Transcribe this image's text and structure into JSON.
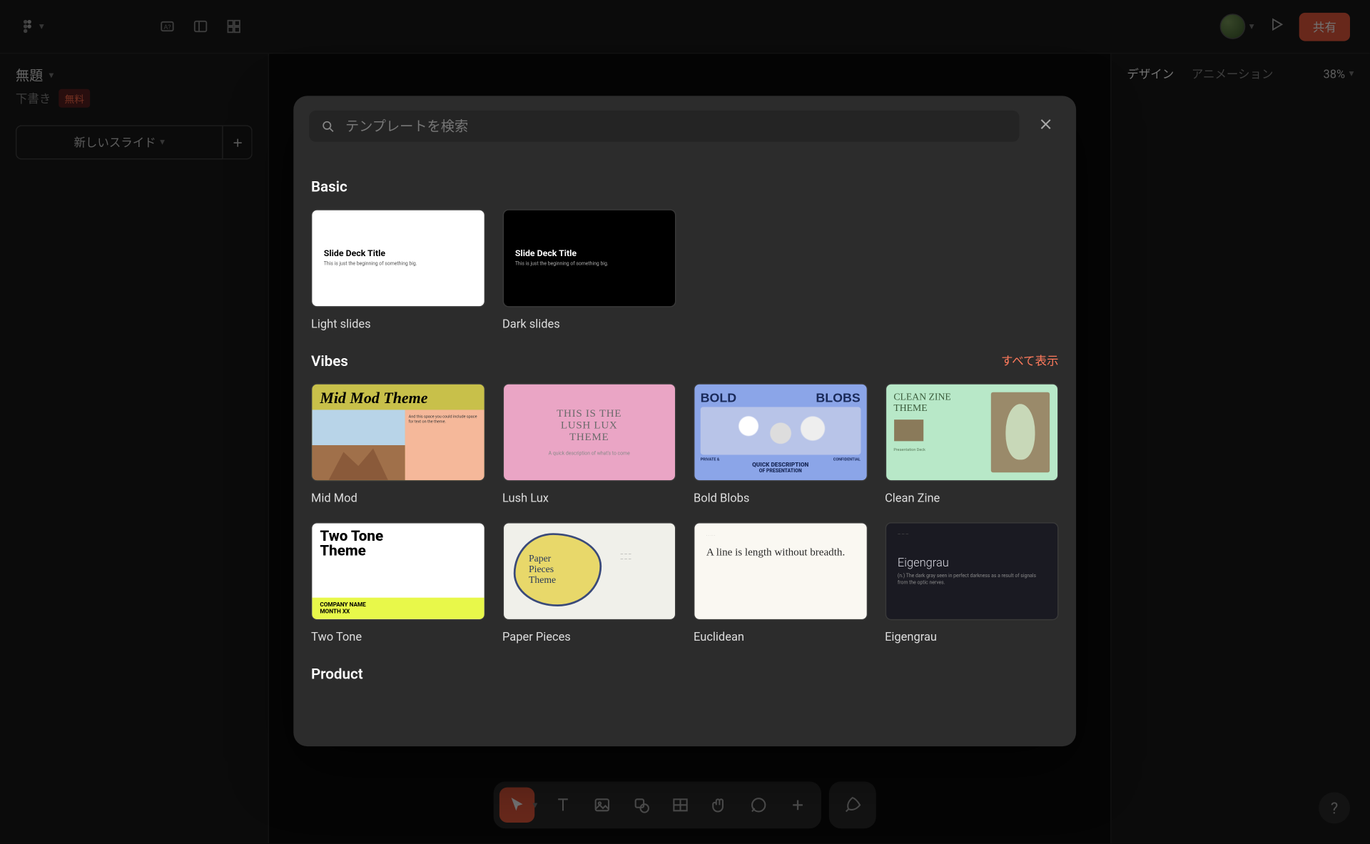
{
  "topbar": {
    "title": "無題",
    "draft": "下書き",
    "free_badge": "無料",
    "share": "共有",
    "new_slide": "新しいスライド"
  },
  "right": {
    "tab_design": "デザイン",
    "tab_animation": "アニメーション",
    "zoom": "38%"
  },
  "modal": {
    "search_placeholder": "テンプレートを検索",
    "show_all": "すべて表示",
    "sections": {
      "basic": "Basic",
      "vibes": "Vibes",
      "product": "Product"
    },
    "templates": {
      "light": {
        "label": "Light slides",
        "title": "Slide Deck Title",
        "subtitle": "This is just the beginning of something big."
      },
      "dark": {
        "label": "Dark slides",
        "title": "Slide Deck Title",
        "subtitle": "This is just the beginning of something big."
      },
      "midmod": {
        "label": "Mid Mod",
        "title": "Mid Mod Theme",
        "side": "And this space you could include space for text on the theme."
      },
      "lushlux": {
        "label": "Lush Lux",
        "title_l1": "THIS IS THE",
        "title_l2": "LUSH LUX",
        "title_l3": "THEME",
        "sub": "A quick description of what's to come"
      },
      "bold": {
        "label": "Bold Blobs",
        "w1": "BOLD",
        "w2": "BLOBS",
        "sub1": "QUICK DESCRIPTION",
        "sub2": "OF PRESENTATION",
        "c1": "PRIVATE &",
        "c2": "CONFIDENTIAL"
      },
      "clean": {
        "label": "Clean Zine",
        "t1": "CLEAN ZINE",
        "t2": "THEME",
        "sub": "Presentation Deck"
      },
      "twotone": {
        "label": "Two Tone",
        "t1": "Two Tone",
        "t2": "Theme",
        "b1": "COMPANY NAME",
        "b2": "MONTH XX"
      },
      "paper": {
        "label": "Paper Pieces",
        "t1": "Paper",
        "t2": "Pieces",
        "t3": "Theme"
      },
      "euclid": {
        "label": "Euclidean",
        "title": "A line is length without breadth."
      },
      "eigen": {
        "label": "Eigengrau",
        "title": "Eigengrau",
        "sub": "(n.) The dark gray seen in perfect darkness as a result of signals from the optic nerves."
      }
    }
  }
}
